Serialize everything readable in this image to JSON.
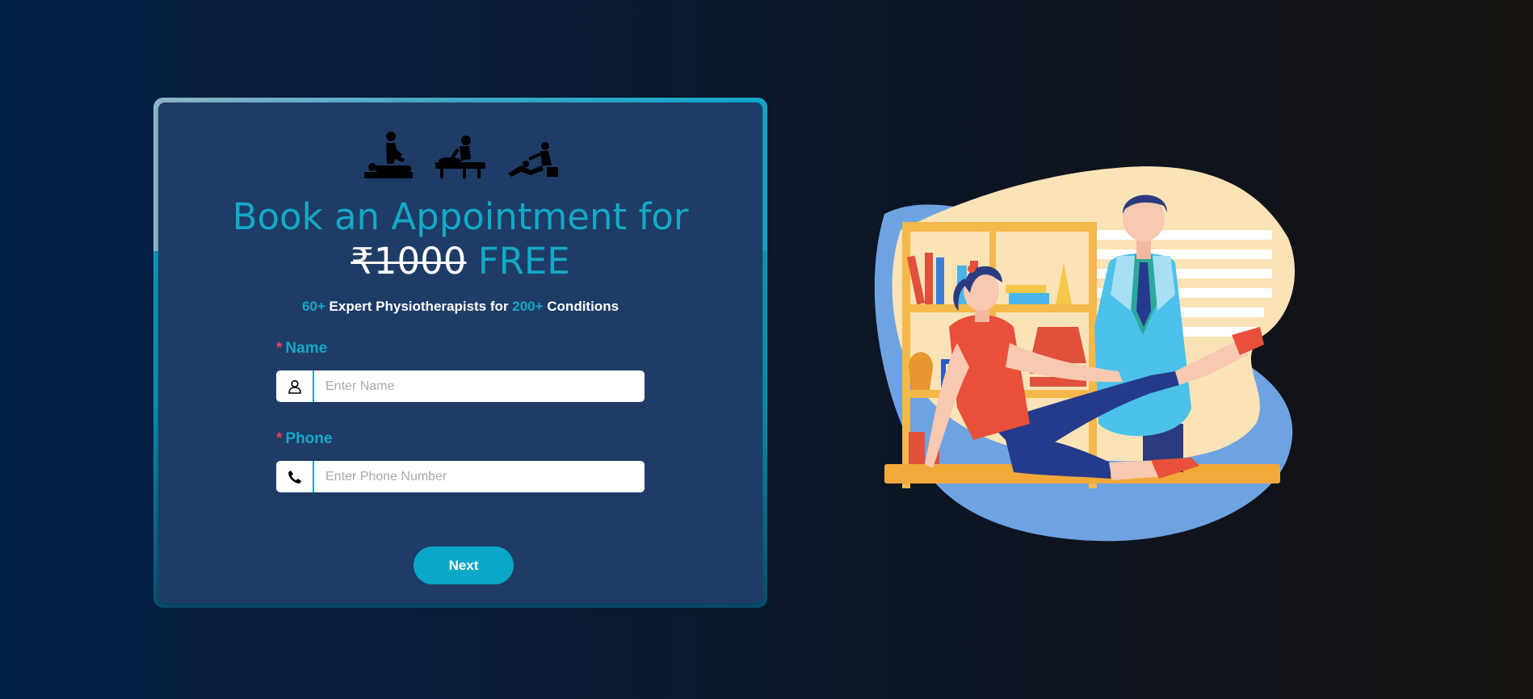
{
  "hero": {
    "title_line1": "Book an Appointment for",
    "price_old": "₹1000",
    "price_free": "FREE",
    "subtitle": {
      "count1": "60+",
      "text1": " Expert Physiotherapists for ",
      "count2": "200+",
      "text2": " Conditions"
    },
    "icons": [
      "massage-icon",
      "physio-treatment-icon",
      "leg-stretch-therapy-icon"
    ]
  },
  "form": {
    "name": {
      "required_mark": "*",
      "label": "Name",
      "placeholder": "Enter Name",
      "value": "",
      "icon": "user-icon"
    },
    "phone": {
      "required_mark": "*",
      "label": "Phone",
      "placeholder": "Enter Phone Number",
      "value": "",
      "icon": "phone-icon"
    },
    "next_label": "Next"
  },
  "illustration": {
    "name": "physiotherapy-illustration"
  },
  "colors": {
    "accent": "#14a9c7",
    "card_bg": "#1e3c66",
    "required": "#e0445a",
    "button": "#0aa7c6"
  }
}
